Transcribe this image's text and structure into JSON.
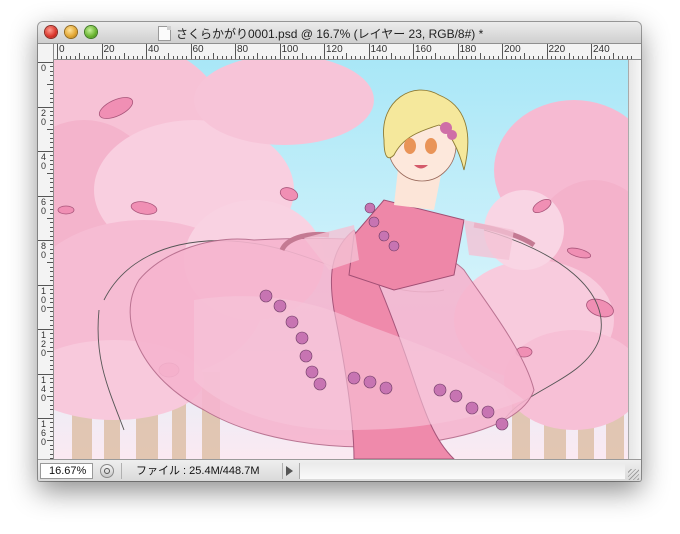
{
  "window": {
    "title": "さくらかがり0001.psd @ 16.7% (レイヤー 23, RGB/8#) *"
  },
  "ruler": {
    "top_labels": [
      "0",
      "20",
      "40",
      "60",
      "80",
      "100",
      "120",
      "140",
      "160",
      "180",
      "200",
      "220",
      "240"
    ],
    "left_labels": [
      "0",
      "20",
      "40",
      "60",
      "80",
      "100",
      "120",
      "140",
      "160"
    ]
  },
  "status": {
    "zoom": "16.67%",
    "file_label": "ファイル : 25.4M/448.7M"
  },
  "canvas": {
    "content": "anime-girl-under-cherry-blossoms",
    "colors": {
      "sky": "#9fe3f5",
      "blossom": "#f4b6cf",
      "dress": "#ee8fae",
      "hair": "#f4e7a0"
    }
  },
  "icons": {
    "close": "close-icon",
    "minimize": "minimize-icon",
    "zoom": "zoom-icon",
    "document": "document-icon",
    "status_menu": "status-menu-icon",
    "arrow": "arrow-right-icon",
    "resize": "resize-grip-icon"
  }
}
